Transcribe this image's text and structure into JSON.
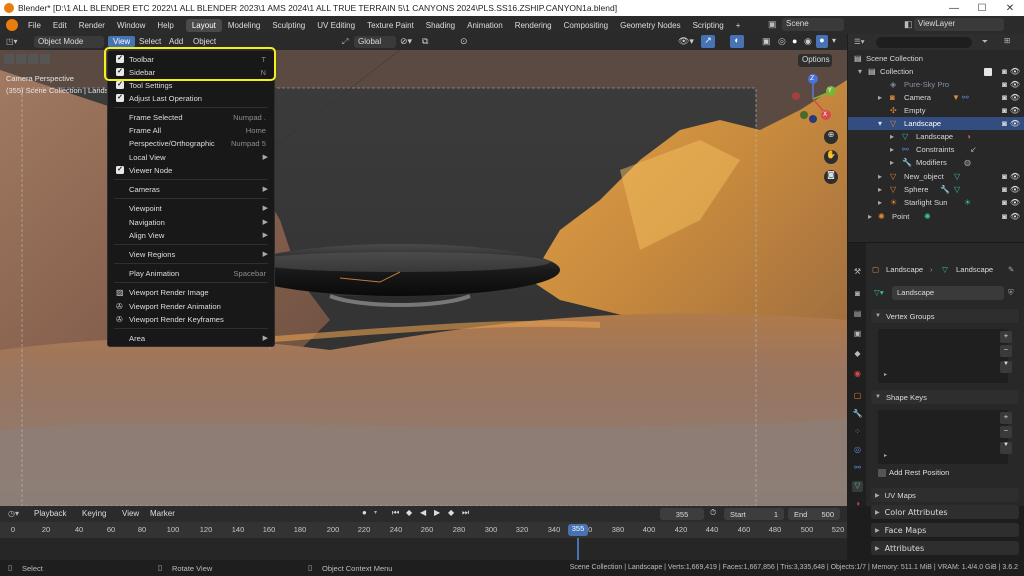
{
  "window": {
    "title": "Blender* [D:\\1 ALL BLENDER ETC 2022\\1 ALL BLENDER 2023\\1 AMS 2024\\1 ALL TRUE TERRAIN 5\\1 CANYONS 2024\\PLS.SS16.ZSHIP.CANYON1a.blend]",
    "minimize": "—",
    "maximize": "☐",
    "close": "✕"
  },
  "menubar": {
    "items": [
      "File",
      "Edit",
      "Render",
      "Window",
      "Help"
    ],
    "workspaces": [
      "Layout",
      "Modeling",
      "Sculpting",
      "UV Editing",
      "Texture Paint",
      "Shading",
      "Animation",
      "Rendering",
      "Compositing",
      "Geometry Nodes",
      "Scripting"
    ],
    "add_workspace": "+",
    "scene": "Scene",
    "view_layer": "ViewLayer"
  },
  "viewport_header": {
    "mode": "Object Mode",
    "menus": [
      "View",
      "Select",
      "Add",
      "Object"
    ],
    "transform": "Global",
    "options": "Options"
  },
  "viewport": {
    "camera_label": "Camera Perspective",
    "collection_label": "(355) Scene Collection | Landscape",
    "gizmo": {
      "z": "Z",
      "y": "Y",
      "x": "X"
    }
  },
  "view_menu": {
    "items": [
      {
        "label": "Toolbar",
        "shortcut": "T",
        "checked": true
      },
      {
        "label": "Sidebar",
        "shortcut": "N",
        "checked": true
      },
      {
        "label": "Tool Settings",
        "shortcut": "",
        "checked": true
      },
      {
        "label": "Adjust Last Operation",
        "shortcut": "",
        "checked": true
      },
      {
        "label": "Frame Selected",
        "shortcut": "Numpad ."
      },
      {
        "label": "Frame All",
        "shortcut": "Home"
      },
      {
        "label": "Perspective/Orthographic",
        "shortcut": "Numpad 5"
      },
      {
        "label": "Local View",
        "shortcut": "",
        "submenu": true
      },
      {
        "label": "Viewer Node",
        "shortcut": "",
        "checked": true
      },
      {
        "label": "Cameras",
        "submenu": true
      },
      {
        "label": "Viewpoint",
        "submenu": true
      },
      {
        "label": "Navigation",
        "submenu": true
      },
      {
        "label": "Align View",
        "submenu": true
      },
      {
        "label": "View Regions",
        "submenu": true
      },
      {
        "label": "Play Animation",
        "shortcut": "Spacebar"
      },
      {
        "label": "Viewport Render Image"
      },
      {
        "label": "Viewport Render Animation"
      },
      {
        "label": "Viewport Render Keyframes"
      },
      {
        "label": "Area",
        "submenu": true
      }
    ]
  },
  "outliner": {
    "rows": [
      {
        "label": "Scene Collection"
      },
      {
        "label": "Collection"
      },
      {
        "label": "Pure-Sky Pro"
      },
      {
        "label": "Camera"
      },
      {
        "label": "Empty"
      },
      {
        "label": "Landscape"
      },
      {
        "label": "Landscape"
      },
      {
        "label": "Constraints"
      },
      {
        "label": "Modifiers"
      },
      {
        "label": "New_object"
      },
      {
        "label": "Sphere"
      },
      {
        "label": "Starlight Sun"
      },
      {
        "label": "Point"
      }
    ]
  },
  "properties": {
    "breadcrumb_object": "Landscape",
    "breadcrumb_data": "Landscape",
    "data_name": "Landscape",
    "panels": {
      "vertex_groups": "Vertex Groups",
      "shape_keys": "Shape Keys",
      "add_rest_position": "Add Rest Position",
      "uv_maps": "UV Maps",
      "color_attributes": "Color Attributes",
      "face_maps": "Face Maps",
      "attributes": "Attributes"
    }
  },
  "timeline": {
    "menus": [
      "Playback",
      "Keying",
      "View",
      "Marker"
    ],
    "current_frame": "355",
    "start_label": "Start",
    "start": "1",
    "end_label": "End",
    "end": "500",
    "ticks": [
      "0",
      "20",
      "40",
      "60",
      "80",
      "100",
      "120",
      "140",
      "160",
      "180",
      "200",
      "220",
      "240",
      "260",
      "280",
      "300",
      "320",
      "340",
      "360",
      "380",
      "400",
      "420",
      "440",
      "460",
      "480",
      "500",
      "520"
    ],
    "playhead": "355"
  },
  "statusbar": {
    "select": "Select",
    "rotate": "Rotate View",
    "context": "Object Context Menu",
    "stats": "Scene Collection | Landscape | Verts:1,669,419 | Faces:1,667,856 | Tris:3,335,648 | Objects:1/7 | Memory: 511.1 MiB | VRAM: 1.4/4.0 GiB | 3.6.2"
  },
  "colors": {
    "accent": "#4772b3",
    "selection_row": "#334d80",
    "highlight_box": "#f5f01a",
    "menu_bg": "#181818",
    "playhead": "#4772b3"
  }
}
